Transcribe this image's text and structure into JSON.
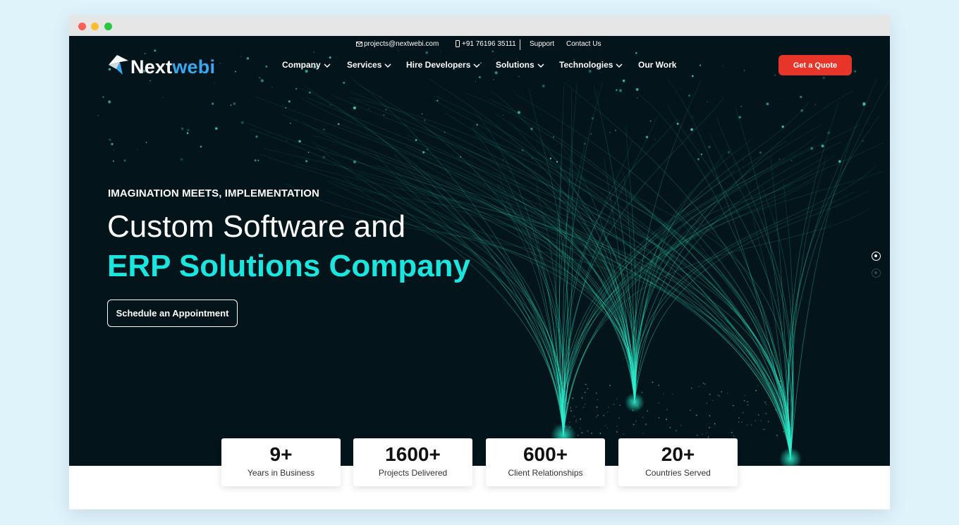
{
  "topbar": {
    "email": "projects@nextwebi.com",
    "phone": "+91 76196 35111",
    "support": "Support",
    "contact": "Contact Us"
  },
  "logo": {
    "part1": "Next",
    "part2": "webi"
  },
  "nav": {
    "company": "Company",
    "services": "Services",
    "hire": "Hire Developers",
    "solutions": "Solutions",
    "technologies": "Technologies",
    "work": "Our Work"
  },
  "cta": {
    "quote": "Get a Quote",
    "appointment": "Schedule an Appointment"
  },
  "hero": {
    "eyebrow": "IMAGINATION MEETS, IMPLEMENTATION",
    "line1": "Custom Software and",
    "line2": "ERP Solutions Company"
  },
  "stats": [
    {
      "value": "9+",
      "label": "Years in Business"
    },
    {
      "value": "1600+",
      "label": "Projects Delivered"
    },
    {
      "value": "600+",
      "label": "Client Relationships"
    },
    {
      "value": "20+",
      "label": "Countries Served"
    }
  ],
  "colors": {
    "accent": "#19e6de",
    "quote_button": "#e8352a",
    "hero_bg": "#03141a",
    "logo_blue": "#3aa7f0"
  },
  "icons": {
    "email": "envelope-icon",
    "phone": "mobile-phone-icon",
    "dropdown": "chevron-down-icon"
  }
}
